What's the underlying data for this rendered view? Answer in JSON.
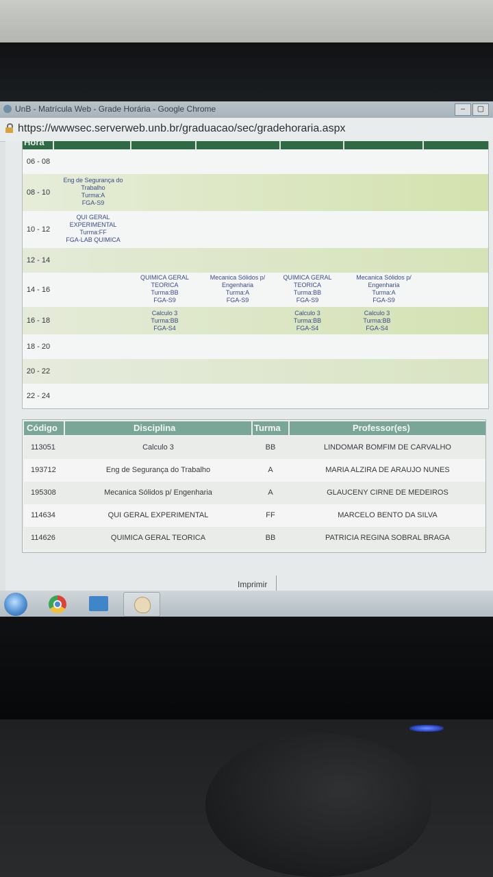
{
  "window": {
    "title": "UnB - Matrícula Web - Grade Horária - Google Chrome",
    "url": "https://wwwsec.serverweb.unb.br/graduacao/sec/gradehoraria.aspx"
  },
  "schedule": {
    "header": "Hora",
    "slots": [
      "06 - 08",
      "08 - 10",
      "10 - 12",
      "12 - 14",
      "14 - 16",
      "16 - 18",
      "18 - 20",
      "20 - 22",
      "22 - 24"
    ],
    "entries": {
      "seg_08": [
        "Eng de Segurança do",
        "Trabalho",
        "Turma:A",
        "FGA-S9"
      ],
      "seg_10": [
        "QUI GERAL",
        "EXPERIMENTAL",
        "Turma:FF",
        "FGA-LAB QUIMICA"
      ],
      "ter_14": [
        "QUIMICA GERAL",
        "TEORICA",
        "Turma:BB",
        "FGA-S9"
      ],
      "qua_14": [
        "Mecanica Sólidos p/",
        "Engenharia",
        "Turma:A",
        "FGA-S9"
      ],
      "qui_14": [
        "QUIMICA GERAL",
        "TEORICA",
        "Turma:BB",
        "FGA-S9"
      ],
      "sex_14": [
        "Mecanica Sólidos p/",
        "Engenharia",
        "Turma:A",
        "FGA-S9"
      ],
      "ter_16": [
        "Calculo 3",
        "Turma:BB",
        "FGA-S4"
      ],
      "qui_16": [
        "Calculo 3",
        "Turma:BB",
        "FGA-S4"
      ],
      "sex_16": [
        "Calculo 3",
        "Turma:BB",
        "FGA-S4"
      ]
    }
  },
  "disciplines": {
    "headers": [
      "Código",
      "Disciplina",
      "Turma",
      "Professor(es)"
    ],
    "rows": [
      [
        "113051",
        "Calculo 3",
        "BB",
        "LINDOMAR BOMFIM DE CARVALHO"
      ],
      [
        "193712",
        "Eng de Segurança do Trabalho",
        "A",
        "MARIA ALZIRA DE ARAUJO NUNES"
      ],
      [
        "195308",
        "Mecanica Sólidos p/ Engenharia",
        "A",
        "GLAUCENY CIRNE DE MEDEIROS"
      ],
      [
        "114634",
        "QUI GERAL EXPERIMENTAL",
        "FF",
        "MARCELO BENTO DA SILVA"
      ],
      [
        "114626",
        "QUIMICA GERAL TEORICA",
        "BB",
        "PATRICIA REGINA SOBRAL BRAGA"
      ]
    ]
  },
  "footer": {
    "print_label": "Imprimir"
  },
  "taskbar": {
    "icons": [
      "windows-start-icon",
      "chrome-icon",
      "network-icon",
      "paint-icon"
    ]
  },
  "colors": {
    "header_green": "#2f6a44",
    "table_header": "#7aa698",
    "band_light": "#d9e6bd",
    "link_blue": "#3b4a8c"
  }
}
